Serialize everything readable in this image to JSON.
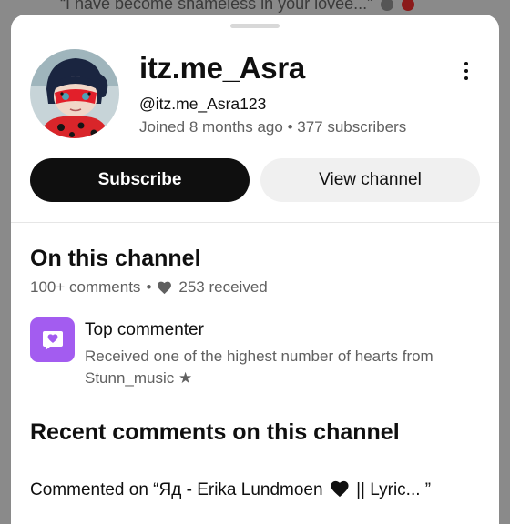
{
  "backdrop": {
    "quote": "“I have become shameless in your lovee...”"
  },
  "profile": {
    "name": "itz.me_Asra",
    "handle": "@itz.me_Asra123",
    "joined": "Joined 8 months ago",
    "separator": "•",
    "subscribers": "377 subscribers"
  },
  "actions": {
    "subscribe": "Subscribe",
    "view_channel": "View channel"
  },
  "on_channel": {
    "title": "On this channel",
    "comments": "100+ comments",
    "separator": "•",
    "hearts": "253 received"
  },
  "badge": {
    "title": "Top commenter",
    "description": "Received one of the highest number of hearts from Stunn_music ★"
  },
  "recent": {
    "title": "Recent comments on this channel",
    "prefix": "Commented on “Яд - Erika Lundmoen",
    "suffix": "|| Lyric... ”"
  },
  "colors": {
    "badge": "#a35cf0",
    "subscribe_bg": "#0f0f0f",
    "secondary_text": "#606060"
  },
  "icons": {
    "more": "more-vert-icon",
    "heart": "heart-icon",
    "badge": "heart-chat-icon"
  }
}
